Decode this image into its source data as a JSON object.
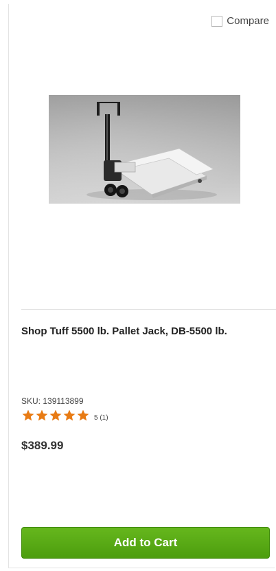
{
  "compare": {
    "label": "Compare",
    "checked": false
  },
  "product": {
    "title": "Shop Tuff 5500 lb. Pallet Jack, DB-5500 lb.",
    "sku_label": "SKU: 139113899",
    "rating": {
      "stars": 5,
      "count_text": "5 (1)"
    },
    "price": "$389.99",
    "image_icon": "pallet-jack-image"
  },
  "actions": {
    "add_to_cart_label": "Add to Cart"
  },
  "colors": {
    "star": "#e87b14",
    "button_green": "#5aaa16",
    "divider": "#d8d8d8"
  }
}
